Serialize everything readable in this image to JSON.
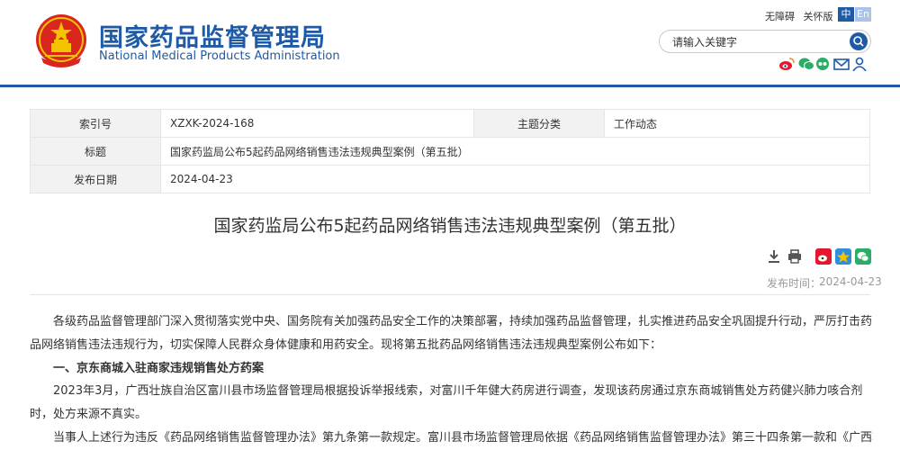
{
  "header": {
    "site_name_cn": "国家药品监督管理局",
    "site_name_en": "National Medical Products Administration",
    "top_links": [
      "无障碍",
      "关怀版"
    ],
    "lang_zh": "中",
    "lang_en": "En",
    "search_placeholder": "请输入关键字",
    "social_icons": [
      "weibo-icon",
      "wechat-icon",
      "email-icon",
      "user-icon"
    ],
    "brand_color": "#1f5aa6"
  },
  "meta": {
    "index_label": "索引号",
    "index_value": "XZXK-2024-168",
    "category_label": "主题分类",
    "category_value": "工作动态",
    "title_label": "标题",
    "title_value": "国家药监局公布5起药品网络销售违法违规典型案例（第五批）",
    "date_label": "发布日期",
    "date_value": "2024-04-23"
  },
  "article": {
    "title": "国家药监局公布5起药品网络销售违法违规典型案例（第五批）",
    "publish_label": "发布时间：",
    "publish_value": "2024-04-23",
    "paragraphs": {
      "intro": "各级药品监督管理部门深入贯彻落实党中央、国务院有关加强药品安全工作的决策部署，持续加强药品监督管理，扎实推进药品安全巩固提升行动，严厉打击药品网络销售违法违规行为，切实保障人民群众身体健康和用药安全。现将第五批药品网络销售违法违规典型案例公布如下：",
      "heading1": "一、京东商城入驻商家违规销售处方药案",
      "case1": "2023年3月，广西壮族自治区富川县市场监督管理局根据投诉举报线索，对富川千年健大药房进行调查，发现该药房通过京东商城销售处方药健兴肺力咳合剂时，处方来源不真实。",
      "case1_cont": "当事人上述行为违反《药品网络销售监督管理办法》第九条第一款规定。富川县市场监督管理局依据《药品网络销售监督管理办法》第三十四条第一款和《广西壮族自"
    }
  }
}
